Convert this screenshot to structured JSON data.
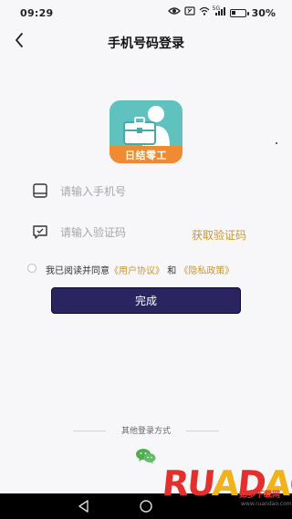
{
  "status_bar": {
    "time": "09:29",
    "network": "5G",
    "battery_text": "30%",
    "battery_level": 0.3
  },
  "header": {
    "title": "手机号码登录",
    "back_icon": "chevron-left-icon"
  },
  "logo": {
    "text": "日结零工",
    "colors": {
      "top": "#5fc2bf",
      "band": "#f08a33"
    }
  },
  "phone_field": {
    "placeholder": "请输入手机号",
    "value": "",
    "icon": "phone-icon"
  },
  "code_field": {
    "placeholder": "请输入验证码",
    "value": "",
    "icon": "message-icon",
    "get_code_label": "获取验证码"
  },
  "agreement": {
    "checked": false,
    "prefix": "我已阅读并同意",
    "user_agreement": "《用户协议》",
    "and": "和",
    "privacy_policy": "《隐私政策》"
  },
  "submit": {
    "label": "完成"
  },
  "other_login": {
    "label": "其他登录方式",
    "wechat_icon": "wechat-icon"
  },
  "watermark": {
    "brand": "RUANDAO",
    "text": "如多下载网",
    "url": "www.ruandao.com"
  },
  "colors": {
    "accent": "#c9982e",
    "button": "#2a2460",
    "background": "#f7f7f9",
    "wechat": "#4caf50"
  }
}
